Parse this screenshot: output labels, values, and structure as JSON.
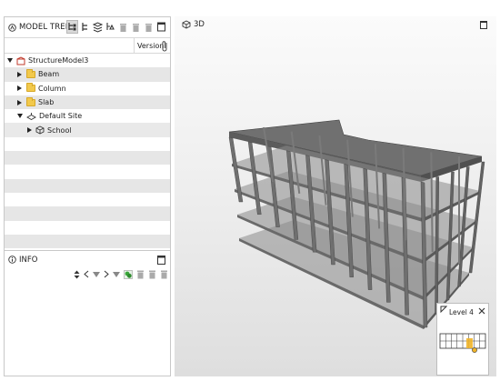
{
  "model_tree": {
    "title": "MODEL TREE",
    "column_version": "Version",
    "items": [
      {
        "label": "StructureModel3",
        "level": 0,
        "expander": "down",
        "icon": "model-icon"
      },
      {
        "label": "Beam",
        "level": 1,
        "expander": "right",
        "icon": "folder-icon"
      },
      {
        "label": "Column",
        "level": 1,
        "expander": "right",
        "icon": "folder-icon"
      },
      {
        "label": "Slab",
        "level": 1,
        "expander": "right",
        "icon": "folder-icon"
      },
      {
        "label": "Default Site",
        "level": 1,
        "expander": "down",
        "icon": "site-icon"
      },
      {
        "label": "School",
        "level": 2,
        "expander": "right",
        "icon": "cube-icon"
      }
    ]
  },
  "info": {
    "title": "INFO"
  },
  "view3d": {
    "title": "3D"
  },
  "minimap": {
    "level_label": "Level 4"
  },
  "colors": {
    "accent_folder": "#f2c94c",
    "highlight": "#f0b429",
    "toggle_green": "#3aa63a"
  }
}
